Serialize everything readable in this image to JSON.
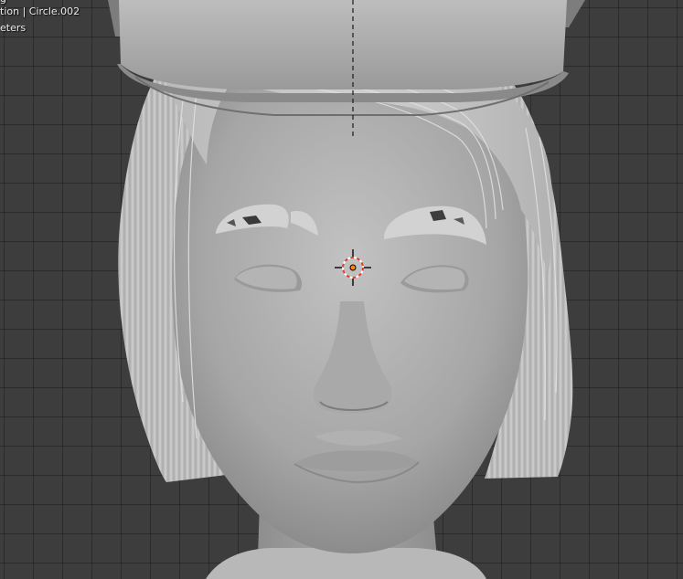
{
  "viewport": {
    "overlay": {
      "line1": "g",
      "line2": "tion | Circle.002",
      "line3": "eters"
    },
    "colors": {
      "grid_background": "#3d3d3d",
      "model_gray": "#a8a8a8",
      "cursor_red": "#e53b2a",
      "origin_orange": "#ff8a00"
    }
  }
}
